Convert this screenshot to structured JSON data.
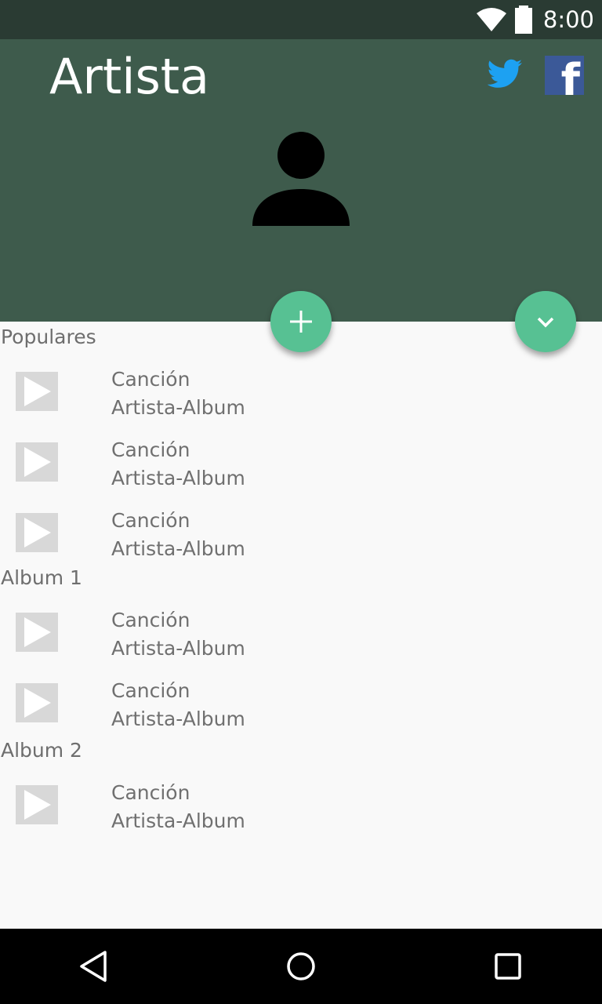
{
  "status_bar": {
    "time": "8:00",
    "icons": [
      "wifi-icon",
      "battery-icon"
    ]
  },
  "header": {
    "title": "Artista",
    "social": [
      "twitter-icon",
      "facebook-icon"
    ],
    "avatar_icon": "person-icon",
    "colors": {
      "status_bar": "#2a3b33",
      "header": "#3e5b4c",
      "fab": "#57c193",
      "twitter": "#1da1f2",
      "facebook": "#3b5998"
    }
  },
  "fabs": {
    "add_icon": "plus-icon",
    "expand_icon": "chevron-down-icon"
  },
  "sections": [
    {
      "title": "Populares",
      "songs": [
        {
          "title": "Canción",
          "subtitle": "Artista-Album"
        },
        {
          "title": "Canción",
          "subtitle": "Artista-Album"
        },
        {
          "title": "Canción",
          "subtitle": "Artista-Album"
        }
      ]
    },
    {
      "title": "Album 1",
      "songs": [
        {
          "title": "Canción",
          "subtitle": "Artista-Album"
        },
        {
          "title": "Canción",
          "subtitle": "Artista-Album"
        }
      ]
    },
    {
      "title": "Album 2",
      "songs": [
        {
          "title": "Canción",
          "subtitle": "Artista-Album"
        }
      ]
    }
  ],
  "nav_bar": {
    "buttons": [
      "back-icon",
      "home-icon",
      "recent-apps-icon"
    ]
  }
}
